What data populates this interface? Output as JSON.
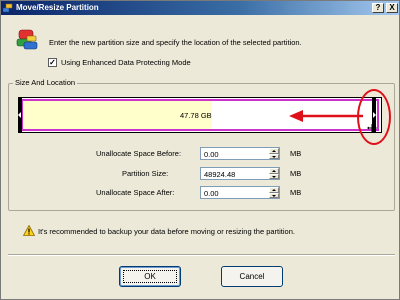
{
  "window": {
    "title": "Move/Resize Partition",
    "help_label": "?",
    "close_label": "X"
  },
  "header": {
    "instruction": "Enter the new partition size and specify the location of the selected partition."
  },
  "enhanced_mode": {
    "checked": true,
    "label": "Using Enhanced Data Protecting Mode"
  },
  "size_location": {
    "legend": "Size And Location",
    "partition_bar": {
      "size_label": "47.78 GB",
      "used_fraction": 0.53,
      "fill_color": "#ffffcc",
      "frame_color": "#cc33cc"
    },
    "annotation_color": "#e0101a",
    "fields": [
      {
        "label": "Unallocate Space Before:",
        "value": "0.00",
        "unit": "MB"
      },
      {
        "label": "Partition Size:",
        "value": "48924.48",
        "unit": "MB"
      },
      {
        "label": "Unallocate Space After:",
        "value": "0.00",
        "unit": "MB"
      }
    ]
  },
  "warning": {
    "text": "It's recommended to backup your data before moving or resizing the partition."
  },
  "buttons": {
    "ok": "OK",
    "cancel": "Cancel"
  }
}
